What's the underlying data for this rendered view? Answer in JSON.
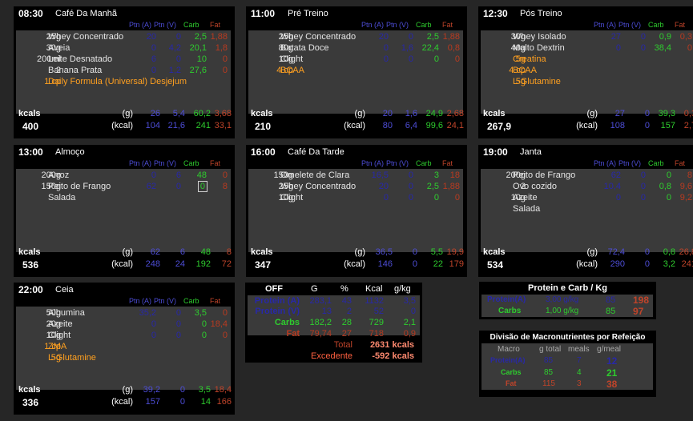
{
  "columns": {
    "ptnA": "Ptn (A)",
    "ptnV": "Ptn (V)",
    "carb": "Carb",
    "fat": "Fat"
  },
  "meals": [
    {
      "time": "08:30",
      "name": "Café Da Manhã",
      "items": [
        {
          "qty": "25g",
          "food": "Whey Concentrado",
          "a": "20",
          "v": "0",
          "c": "2,5",
          "f": "1,88"
        },
        {
          "qty": "30g",
          "food": "Aveia",
          "a": "0",
          "v": "4,2",
          "c": "20,1",
          "f": "1,8"
        },
        {
          "qty": "200ml",
          "food": "Leite Desnatado",
          "a": "6",
          "v": "0",
          "c": "10",
          "f": "0"
        },
        {
          "qty": "2",
          "food": "Banana Prata",
          "a": "0",
          "v": "1,2",
          "c": "27,6",
          "f": "0"
        },
        {
          "qty": "1 cp",
          "food": "Daily Formula (Universal) Desjejum",
          "orange": true
        }
      ],
      "kcals": "400",
      "tg": {
        "a": "26",
        "v": "5,4",
        "c": "60,2",
        "f": "3,68"
      },
      "tk": {
        "a": "104",
        "v": "21,6",
        "c": "241",
        "f": "33,1"
      }
    },
    {
      "time": "11:00",
      "name": "Pré Treino",
      "items": [
        {
          "qty": "25g",
          "food": "Whey Concentrado",
          "a": "20",
          "v": "0",
          "c": "2,5",
          "f": "1,88"
        },
        {
          "qty": "80g",
          "food": "Batata Doce",
          "a": "0",
          "v": "1,6",
          "c": "22,4",
          "f": "0,8"
        },
        {
          "qty": "10g",
          "food": "Clight",
          "a": "0",
          "v": "0",
          "c": "0",
          "f": "0"
        },
        {
          "qty": "4 cp",
          "food": "BCAA",
          "orange": true
        }
      ],
      "kcals": "210",
      "tg": {
        "a": "20",
        "v": "1,6",
        "c": "24,9",
        "f": "2,68"
      },
      "tk": {
        "a": "80",
        "v": "6,4",
        "c": "99,6",
        "f": "24,1"
      }
    },
    {
      "time": "12:30",
      "name": "Pós Treino",
      "items": [
        {
          "qty": "30g",
          "food": "Whey Isolado",
          "a": "27",
          "v": "0",
          "c": "0,9",
          "f": "0,3"
        },
        {
          "qty": "40g",
          "food": "Malto Dextrin",
          "a": "0",
          "v": "0",
          "c": "38,4",
          "f": "0"
        },
        {
          "qty": "5g",
          "food": "Creatina",
          "orange": true
        },
        {
          "qty": "4 cp",
          "food": "BCAA",
          "orange": true
        },
        {
          "qty": "5g",
          "food": "L-Glutamine",
          "orange": true
        }
      ],
      "kcals": "267,9",
      "tg": {
        "a": "27",
        "v": "0",
        "c": "39,3",
        "f": "0,3"
      },
      "tk": {
        "a": "108",
        "v": "0",
        "c": "157",
        "f": "2,7"
      }
    },
    {
      "time": "13:00",
      "name": "Almoço",
      "items": [
        {
          "qty": "200g",
          "food": "Arroz",
          "a": "0",
          "v": "6",
          "c": "48",
          "f": "0"
        },
        {
          "qty": "150g",
          "food": "Peito de Frango",
          "a": "62",
          "v": "0",
          "c": "0",
          "f": "8",
          "sel": true
        },
        {
          "qty": "",
          "food": "Salada"
        }
      ],
      "kcals": "536",
      "tg": {
        "a": "62",
        "v": "6",
        "c": "48",
        "f": "8"
      },
      "tk": {
        "a": "248",
        "v": "24",
        "c": "192",
        "f": "72"
      }
    },
    {
      "time": "16:00",
      "name": "Café Da Tarde",
      "items": [
        {
          "qty": "150g",
          "food": "Omelete de Clara",
          "a": "16,5",
          "v": "0",
          "c": "3",
          "f": "18"
        },
        {
          "qty": "25g",
          "food": "Whey Concentrado",
          "a": "20",
          "v": "0",
          "c": "2,5",
          "f": "1,88"
        },
        {
          "qty": "10g",
          "food": "Clight",
          "a": "0",
          "v": "0",
          "c": "0",
          "f": "0"
        }
      ],
      "kcals": "347",
      "tg": {
        "a": "36,5",
        "v": "0",
        "c": "5,5",
        "f": "19,9"
      },
      "tk": {
        "a": "146",
        "v": "0",
        "c": "22",
        "f": "179"
      }
    },
    {
      "time": "19:00",
      "name": "Janta",
      "items": [
        {
          "qty": "200g",
          "food": "Peito de Frango",
          "a": "62",
          "v": "0",
          "c": "0",
          "f": "8"
        },
        {
          "qty": "2",
          "food": "Ovo cozido",
          "a": "10,4",
          "v": "0",
          "c": "0,8",
          "f": "9,6"
        },
        {
          "qty": "10g",
          "food": "Azeite",
          "a": "0",
          "v": "0",
          "c": "0",
          "f": "9,2"
        },
        {
          "qty": "",
          "food": "Salada"
        }
      ],
      "kcals": "534",
      "tg": {
        "a": "72,4",
        "v": "0",
        "c": "0,8",
        "f": "26,8"
      },
      "tk": {
        "a": "290",
        "v": "0",
        "c": "3,2",
        "f": "241"
      }
    },
    {
      "time": "22:00",
      "name": "Ceia",
      "items": [
        {
          "qty": "50g",
          "food": "Albumina",
          "a": "35,2",
          "v": "0",
          "c": "3,5",
          "f": "0"
        },
        {
          "qty": "20g",
          "food": "Azeite",
          "a": "0",
          "v": "0",
          "c": "0",
          "f": "18,4"
        },
        {
          "qty": "10g",
          "food": "Clight",
          "a": "0",
          "v": "0",
          "c": "0",
          "f": "0"
        },
        {
          "qty": "1 cp",
          "food": "ZMA",
          "orange": true
        },
        {
          "qty": "5g",
          "food": "L-Glutamine",
          "orange": true
        }
      ],
      "kcals": "336",
      "tg": {
        "a": "39,2",
        "v": "0",
        "c": "3,5",
        "f": "18,4"
      },
      "tk": {
        "a": "157",
        "v": "0",
        "c": "14",
        "f": "166"
      }
    }
  ],
  "labels": {
    "kcals": "kcals",
    "g": "(g)",
    "kcal": "(kcal)"
  },
  "summary": {
    "headers": [
      "OFF",
      "G",
      "%",
      "Kcal",
      "g/kg"
    ],
    "rows": [
      {
        "label": "Protein (A)",
        "g": "283,1",
        "pct": "43",
        "kcal": "1132",
        "gkg": "3,5"
      },
      {
        "label": "Protein (V)",
        "g": "13",
        "pct": "2",
        "kcal": "52",
        "gkg": "0"
      },
      {
        "label": "Carbs",
        "g": "182,2",
        "pct": "28",
        "kcal": "729",
        "gkg": "2,1"
      },
      {
        "label": "Fat",
        "g": "79,74",
        "pct": "27",
        "kcal": "718",
        "gkg": "0,9"
      }
    ],
    "total_label": "Total",
    "total": "2631 kcals",
    "excess_label": "Excedente",
    "excess": "-592 kcals"
  },
  "pc": {
    "title": "Protein e Carb / Kg",
    "rows": [
      {
        "label": "Protein(A)",
        "gkg": "3,00 g/kg",
        "val": "85",
        "big": "198"
      },
      {
        "label": "Carbs",
        "gkg": "1,00 g/kg",
        "val": "85",
        "big": "97"
      }
    ]
  },
  "div": {
    "title": "Divisão de Macronutrientes por Refeição",
    "headers": [
      "Macro",
      "g total",
      "meals",
      "g/meal"
    ],
    "rows": [
      {
        "label": "Protein(A)",
        "gt": "85",
        "meals": "7",
        "gm": "12"
      },
      {
        "label": "Carbs",
        "gt": "85",
        "meals": "4",
        "gm": "21"
      },
      {
        "label": "Fat",
        "gt": "115",
        "meals": "3",
        "gm": "38"
      }
    ]
  }
}
